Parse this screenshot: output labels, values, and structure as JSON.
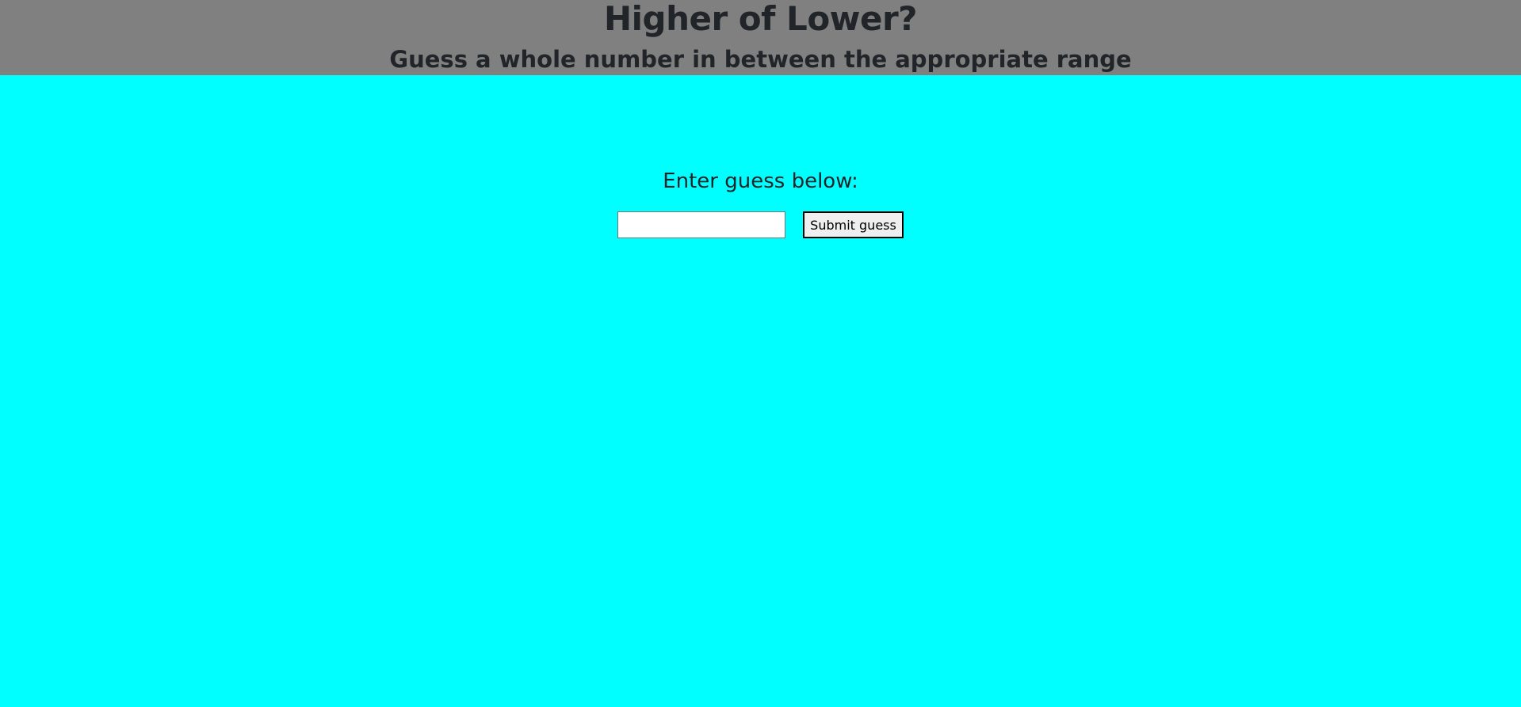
{
  "header": {
    "title": "Higher of Lower?",
    "subtitle": "Guess a whole number in between the appropriate range"
  },
  "main": {
    "prompt": "Enter guess below:",
    "guess_input": {
      "value": "",
      "placeholder": ""
    },
    "submit_label": "Submit guess"
  },
  "colors": {
    "page_background": "#00ffff",
    "header_background": "#808080",
    "text": "#212529"
  }
}
